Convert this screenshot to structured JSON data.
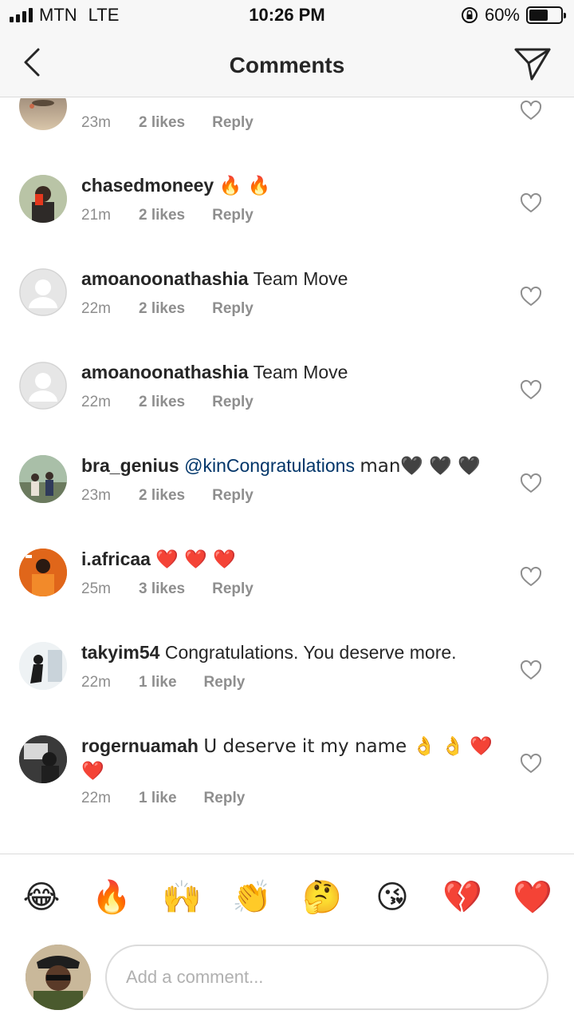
{
  "status_bar": {
    "carrier": "MTN",
    "network": "LTE",
    "time": "10:26 PM",
    "battery_percent": "60%",
    "battery_level": 0.6
  },
  "header": {
    "title": "Comments",
    "back_icon": "chevron-left-icon",
    "send_icon": "paper-plane-icon"
  },
  "comments": [
    {
      "username": "",
      "text": "",
      "time": "23m",
      "likes": "2 likes",
      "reply": "Reply"
    },
    {
      "username": "chasedmoneey",
      "text": "🔥 🔥",
      "time": "21m",
      "likes": "2 likes",
      "reply": "Reply"
    },
    {
      "username": "amoanoonathashia",
      "text": "Team Move",
      "time": "22m",
      "likes": "2 likes",
      "reply": "Reply"
    },
    {
      "username": "amoanoonathashia",
      "text": "Team Move",
      "time": "22m",
      "likes": "2 likes",
      "reply": "Reply"
    },
    {
      "username": "bra_genius",
      "mention": "@kinCongratulations",
      "text": "man🖤 🖤 🖤",
      "time": "23m",
      "likes": "2 likes",
      "reply": "Reply"
    },
    {
      "username": "i.africaa",
      "text": "❤️ ❤️ ❤️",
      "time": "25m",
      "likes": "3 likes",
      "reply": "Reply"
    },
    {
      "username": "takyim54",
      "text": "Congratulations. You deserve more.",
      "time": "22m",
      "likes": "1 like",
      "reply": "Reply"
    },
    {
      "username": "rogernuamah",
      "text": "U deserve it my name 👌 👌 ❤️ ❤️",
      "time": "22m",
      "likes": "1 like",
      "reply": "Reply"
    }
  ],
  "emoji_bar": [
    "😂",
    "🔥",
    "🙌",
    "👏",
    "🤔",
    "😘",
    "💔",
    "❤️"
  ],
  "composer": {
    "placeholder": "Add a comment..."
  },
  "colors": {
    "mention": "#003569",
    "meta": "#8e8e8e",
    "text": "#262626",
    "divider": "#dbdbdb"
  }
}
